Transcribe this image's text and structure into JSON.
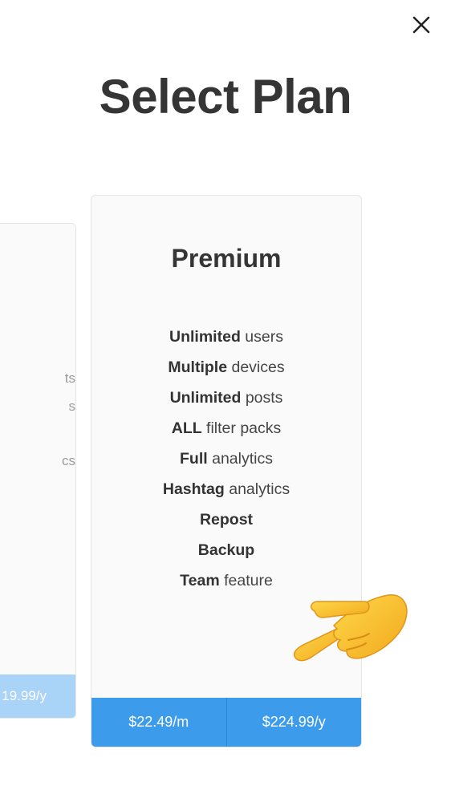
{
  "header": {
    "title": "Select Plan",
    "close_icon": "close-icon"
  },
  "left_card": {
    "features": [
      "ts",
      "s",
      "cs"
    ],
    "price": "19.99/y"
  },
  "main_card": {
    "title": "Premium",
    "features": [
      {
        "bold": "Unlimited",
        "rest": " users"
      },
      {
        "bold": "Multiple",
        "rest": " devices"
      },
      {
        "bold": "Unlimited",
        "rest": " posts"
      },
      {
        "bold": "ALL",
        "rest": " filter packs"
      },
      {
        "bold": "Full",
        "rest": " analytics"
      },
      {
        "bold": "Hashtag",
        "rest": " analytics"
      },
      {
        "bold": "Repost",
        "rest": ""
      },
      {
        "bold": "Backup",
        "rest": ""
      },
      {
        "bold": "Team",
        "rest": " feature"
      }
    ],
    "monthly_price": "$22.49/m",
    "yearly_price": "$224.99/y"
  },
  "decoration": {
    "icon": "pointing-hand-icon"
  },
  "colors": {
    "accent": "#3d9bec",
    "accent_light": "#a9d3f7",
    "title": "#353535"
  }
}
